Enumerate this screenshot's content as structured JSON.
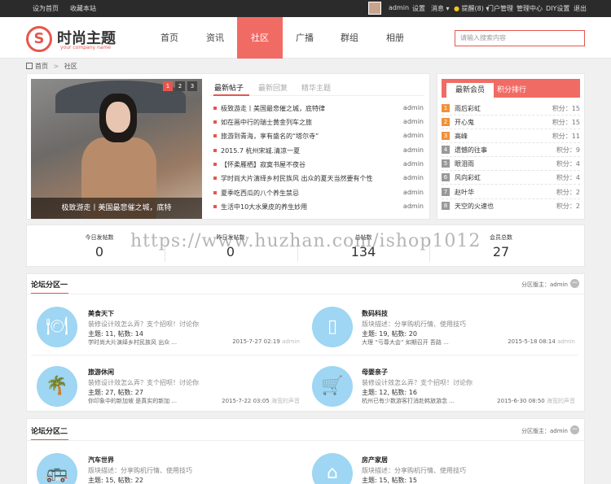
{
  "topbar": {
    "set_home": "设为首页",
    "bookmark": "收藏本站",
    "user": "admin",
    "settings": "设置",
    "messages": "消息",
    "reminders": "提醒(8)",
    "portal": "门户管理",
    "admin_center": "管理中心",
    "diy": "DIY设置",
    "logout": "退出"
  },
  "header": {
    "logo_mark": "S",
    "logo_title": "时尚主题",
    "logo_sub": "your company name",
    "search_placeholder": "请输入搜索内容"
  },
  "nav": [
    "首页",
    "资讯",
    "社区",
    "广播",
    "群组",
    "相册"
  ],
  "breadcrumb": {
    "home": "首页",
    "sep": ">",
    "current": "社区"
  },
  "slider": {
    "caption": "极致游走丨美国最悲催之城，底特",
    "pages": [
      "1",
      "2",
      "3"
    ]
  },
  "posts_tabs": [
    "最新帖子",
    "最新回复",
    "精华主题"
  ],
  "posts": [
    {
      "title": "极致游走丨美国最悲催之城，底特律",
      "author": "admin"
    },
    {
      "title": "如在画中行的瑞士黄金列车之旅",
      "author": "admin"
    },
    {
      "title": "旅游到青海，享有盛名的“塔尔寺”",
      "author": "admin"
    },
    {
      "title": "2015.7 杭州宋城.清凉一夏",
      "author": "admin"
    },
    {
      "title": "【怀柔雁栖】寂寞书屋不夜谷",
      "author": "admin"
    },
    {
      "title": "学时尚大片演绎乡村民族风 出众的夏天当然要有个性",
      "author": "admin"
    },
    {
      "title": "夏季吃西瓜的八个养生禁忌",
      "author": "admin"
    },
    {
      "title": "生活中10大水果皮的养生妙用",
      "author": "admin"
    }
  ],
  "ranking_tabs": [
    "最新会员",
    "积分排行"
  ],
  "ranking": [
    {
      "n": "1",
      "name": "雨后彩虹",
      "score": "积分：15"
    },
    {
      "n": "2",
      "name": "开心鬼",
      "score": "积分：15"
    },
    {
      "n": "3",
      "name": "高峰",
      "score": "积分：11"
    },
    {
      "n": "4",
      "name": "遗憾的往事",
      "score": "积分：9"
    },
    {
      "n": "5",
      "name": "眼泪雨",
      "score": "积分：4"
    },
    {
      "n": "6",
      "name": "风向彩虹",
      "score": "积分：4"
    },
    {
      "n": "7",
      "name": "赵叶华",
      "score": "积分：2"
    },
    {
      "n": "8",
      "name": "天空的火速也",
      "score": "积分：2"
    }
  ],
  "stats": [
    {
      "label": "今日发帖数",
      "value": "0"
    },
    {
      "label": "昨日发帖数",
      "value": "0"
    },
    {
      "label": "总帖数",
      "value": "134"
    },
    {
      "label": "会员总数",
      "value": "27"
    }
  ],
  "watermark": "https://www.huzhan.com/ishop1012",
  "sections": [
    {
      "title": "论坛分区一",
      "moderator": "分区版主：admin",
      "forums": [
        {
          "icon": "dining-icon",
          "name": "美食天下",
          "desc": "装修设计效怎么弄？支个招呗！讨论你",
          "counts": "主题: 11, 帖数: 14",
          "last": "学时尚大片演绎乡村民族风 出众 ...",
          "date": "2015-7-27 02:19",
          "by": "admin"
        },
        {
          "icon": "phone-icon",
          "name": "数码科技",
          "desc": "版块描述：分享购机行情、使用技巧",
          "counts": "主题: 19, 帖数: 20",
          "last": "大理 “亏尊大会” 如期召开 吾路 ...",
          "date": "2015-5-18 08:14",
          "by": "admin"
        },
        {
          "icon": "palm-tree-icon",
          "name": "旅游休闲",
          "desc": "装修设计效怎么弄？支个招呗！讨论你",
          "counts": "主题: 27, 帖数: 27",
          "last": "你印象中的新加坡 是真实的新加 ...",
          "date": "2015-7-22 03:05",
          "by": "海宽的声音"
        },
        {
          "icon": "stroller-icon",
          "name": "母婴亲子",
          "desc": "装修设计效怎么弄？支个招呗！讨论你",
          "counts": "主题: 12, 帖数: 16",
          "last": "杭州已有少数游客打消赴韩旅游念 ...",
          "date": "2015-6-30 08:50",
          "by": "海宽的声音"
        }
      ]
    },
    {
      "title": "论坛分区二",
      "moderator": "分区版主：admin",
      "forums": [
        {
          "icon": "bus-icon",
          "name": "汽车世界",
          "desc": "版块描述：分享购机行情、使用技巧",
          "counts": "主题: 15, 帖数: 22"
        },
        {
          "icon": "house-icon",
          "name": "房产家居",
          "desc": "版块描述：分享购机行情、使用技巧",
          "counts": "主题: 15, 帖数: 15"
        }
      ]
    }
  ]
}
